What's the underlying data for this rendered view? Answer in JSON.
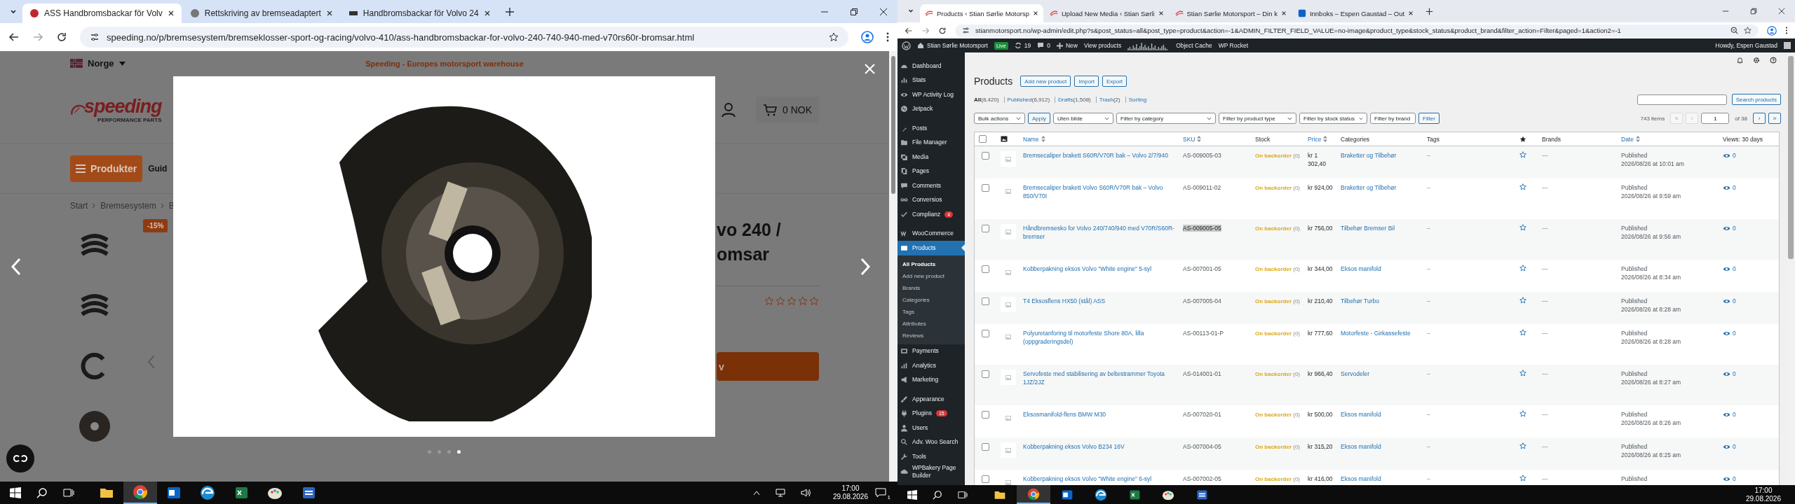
{
  "left_window": {
    "tabs": [
      {
        "title": "ASS Handbromsbackar för Volv",
        "selected": true
      },
      {
        "title": "Rettskriving av bremseadaptert",
        "selected": false
      },
      {
        "title": "Handbromsbackar för Volvo 24",
        "selected": false
      }
    ],
    "url": "speeding.no/p/bremsesystem/bremseklosser-sport-og-racing/volvo-410/ass-handbromsbackar-for-volvo-240-740-940-med-v70rs60r-bromsar.html",
    "site": {
      "country": "Norge",
      "tagline": "Speeding - Europes motorsport warehouse",
      "logo": "speeding",
      "logo_tagline": "PERFORMANCE PARTS",
      "cart": "0 NOK",
      "menu_button": "Produkter",
      "nav_link": "Guid",
      "breadcrumb": [
        "Start",
        "Bremsesystem",
        "B"
      ],
      "discount_badge": "-15%",
      "title_lines": [
        "vo 240 /",
        "omsar"
      ],
      "stars": 0,
      "cart_button": "v"
    },
    "lightbox": {
      "dots": [
        {
          "selected": false
        },
        {
          "selected": false
        },
        {
          "selected": false
        },
        {
          "selected": true
        }
      ]
    }
  },
  "left_taskbar": {
    "apps": [
      {
        "selected": false
      },
      {
        "selected": true
      },
      {
        "selected": false
      },
      {
        "selected": false
      },
      {
        "selected": false
      },
      {
        "selected": false
      },
      {
        "selected": false
      }
    ],
    "time": "17:00",
    "date": "29.08.2026",
    "notification_count": "1"
  },
  "right_window": {
    "tabs": [
      {
        "title": "Products ‹ Stian Sørlie Motorsp",
        "selected": true
      },
      {
        "title": "Upload New Media ‹ Stian Sørli",
        "selected": false
      },
      {
        "title": "Stian Sørlie Motorsport – Din k",
        "selected": false
      },
      {
        "title": "Innboks – Espen Gaustad – Out",
        "selected": false
      }
    ],
    "url": "stianmotorsport.no/wp-admin/edit.php?s&post_status=all&post_type=product&action=-1&ADMIN_FILTER_FIELD_VALUE=no-image&product_type&stock_status&product_brand&filter_action=Filter&paged=1&action2=-1",
    "admin_bar": {
      "site": "Stian Sørlie Motorsport",
      "live_badge": "Live",
      "updates": "19",
      "comments": "0",
      "new": "New",
      "view": "View products",
      "links": [
        "Object Cache",
        "WP Rocket"
      ],
      "howdy": "Howdy, Espen Gaustad"
    },
    "sidebar": [
      {
        "items": [
          {
            "label": "Dashboard",
            "selected": false
          },
          {
            "label": "Stats",
            "selected": false
          },
          {
            "label": "WP Activity Log",
            "selected": false
          },
          {
            "label": "Jetpack",
            "selected": false
          }
        ]
      },
      {
        "items": [
          {
            "label": "Posts",
            "selected": false
          },
          {
            "label": "File Manager",
            "selected": false
          },
          {
            "label": "Media",
            "selected": false
          },
          {
            "label": "Pages",
            "selected": false
          },
          {
            "label": "Comments",
            "selected": false
          },
          {
            "label": "Conversios",
            "selected": false
          },
          {
            "label": "Complianz",
            "selected": false,
            "badge": "4"
          }
        ]
      },
      {
        "items": [
          {
            "label": "WooCommerce",
            "selected": false
          },
          {
            "label": "Products",
            "selected": true,
            "children": [
              {
                "label": "All Products",
                "selected": true
              },
              {
                "label": "Add new product",
                "selected": false
              },
              {
                "label": "Brands",
                "selected": false
              },
              {
                "label": "Categories",
                "selected": false
              },
              {
                "label": "Tags",
                "selected": false
              },
              {
                "label": "Attributes",
                "selected": false
              },
              {
                "label": "Reviews",
                "selected": false
              }
            ]
          },
          {
            "label": "Payments",
            "selected": false
          },
          {
            "label": "Analytics",
            "selected": false
          },
          {
            "label": "Marketing",
            "selected": false
          }
        ]
      },
      {
        "items": [
          {
            "label": "Appearance",
            "selected": false
          },
          {
            "label": "Plugins",
            "selected": false,
            "badge": "15"
          },
          {
            "label": "Users",
            "selected": false
          },
          {
            "label": "Adv. Woo Search",
            "selected": false
          },
          {
            "label": "Tools",
            "selected": false
          },
          {
            "label": "WPBakery Page Builder",
            "selected": false
          }
        ]
      }
    ],
    "page": {
      "heading": "Products",
      "buttons": [
        "Add new product",
        "Import",
        "Export"
      ],
      "views": [
        {
          "label": "All",
          "count": "(8,420)",
          "selected": true
        },
        {
          "label": "Published",
          "count": "(6,912)",
          "selected": false
        },
        {
          "label": "Drafts",
          "count": "(1,508)",
          "selected": false
        },
        {
          "label": "Trash",
          "count": "(2)",
          "selected": false
        },
        {
          "label": "Sorting",
          "selected": false
        }
      ],
      "search_button": "Search products",
      "bulk_select": "Bulk actions",
      "apply_button": "Apply",
      "filters": [
        "Uten bilde",
        "Filter by category",
        "Filter by product type",
        "Filter by stock status",
        "Filter by brand"
      ],
      "filter_button": "Filter",
      "items_count": "743 items",
      "pagination": {
        "first": "«",
        "prev": "‹",
        "page": "1",
        "of": "of 38",
        "next": "›",
        "last": "»"
      }
    },
    "table": {
      "select_all_checked": false,
      "columns": [
        {
          "kind": "text",
          "label": "Name",
          "sortable": true
        },
        {
          "kind": "text",
          "label": "SKU",
          "sortable": true
        },
        {
          "kind": "text",
          "label": "Stock",
          "sortable": false
        },
        {
          "kind": "text",
          "label": "Price",
          "sortable": true
        },
        {
          "kind": "text",
          "label": "Categories",
          "sortable": false
        },
        {
          "kind": "text",
          "label": "Tags",
          "sortable": false
        },
        {
          "kind": "featured"
        },
        {
          "kind": "text",
          "label": "Brands",
          "sortable": false
        },
        {
          "kind": "text",
          "label": "Date",
          "sortable": true
        },
        {
          "kind": "text",
          "label": "Views: 30 days",
          "sortable": false
        }
      ],
      "rows": [
        {
          "checked": false,
          "name": "Bremsecaliper brakett S60R/V70R bak – Volvo 2/7/940",
          "sku": "AS-009005-03",
          "sku_highlighted": false,
          "stock": "On backorder",
          "stock_count": "(0)",
          "price": "kr 1 302,40",
          "category": "Braketter og Tilbehør",
          "tags": "–",
          "featured": false,
          "brands": "—",
          "status": "Published",
          "date": "2026/08/26 at 10:01 am",
          "views": "0"
        },
        {
          "checked": false,
          "name": "Bremsecaliper brakett Volvo S60R/V70R bak – Volvo 850/V70I",
          "sku": "AS-009011-02",
          "sku_highlighted": false,
          "stock": "On backorder",
          "stock_count": "(0)",
          "price": "kr 924,00",
          "category": "Braketter og Tilbehør",
          "tags": "–",
          "featured": false,
          "brands": "—",
          "status": "Published",
          "date": "2026/08/26 at 9:59 am",
          "views": "0"
        },
        {
          "checked": false,
          "name": "Håndbremsesko for Volvo 240/740/940 med V70R/S60R-bremser",
          "sku": "AS-009005-05",
          "sku_highlighted": true,
          "stock": "On backorder",
          "stock_count": "(0)",
          "price": "kr 756,00",
          "category": "Tilbehør Bremser Bil",
          "tags": "–",
          "featured": false,
          "brands": "—",
          "status": "Published",
          "date": "2026/08/26 at 9:56 am",
          "views": "0"
        },
        {
          "checked": false,
          "name": "Kobberpakning eksos Volvo \"White engine\" 5-syl",
          "sku": "AS-007001-05",
          "sku_highlighted": false,
          "stock": "On backorder",
          "stock_count": "(0)",
          "price": "kr 344,00",
          "category": "Eksos manifold",
          "tags": "–",
          "featured": false,
          "brands": "—",
          "status": "Published",
          "date": "2026/08/26 at 8:34 am",
          "views": "0"
        },
        {
          "checked": false,
          "name": "T4 Eksosflens HX50 (stål) ASS",
          "sku": "AS-007005-04",
          "sku_highlighted": false,
          "stock": "On backorder",
          "stock_count": "(0)",
          "price": "kr 210,40",
          "category": "Tilbehør Turbo",
          "tags": "–",
          "featured": false,
          "brands": "—",
          "status": "Published",
          "date": "2026/08/26 at 8:28 am",
          "views": "0"
        },
        {
          "checked": false,
          "name": "Polyuretanforing til motorfeste Shore 80A, lilla (oppgraderingsdel)",
          "sku": "AS-00113-01-P",
          "sku_highlighted": false,
          "stock": "On backorder",
          "stock_count": "(0)",
          "price": "kr 777,60",
          "category": "Motorfeste - Girkassefeste",
          "tags": "–",
          "featured": false,
          "brands": "—",
          "status": "Published",
          "date": "2026/08/26 at 8:28 am",
          "views": "0"
        },
        {
          "checked": false,
          "name": "Servofeste med stabilisering av beltestrammer Toyota 1JZ/2JZ",
          "sku": "AS-014001-01",
          "sku_highlighted": false,
          "stock": "On backorder",
          "stock_count": "(0)",
          "price": "kr 966,40",
          "category": "Servodeler",
          "tags": "–",
          "featured": false,
          "brands": "—",
          "status": "Published",
          "date": "2026/08/26 at 8:27 am",
          "views": "0"
        },
        {
          "checked": false,
          "name": "Eksosmanifold-flens BMW M30",
          "sku": "AS-007020-01",
          "sku_highlighted": false,
          "stock": "On backorder",
          "stock_count": "(0)",
          "price": "kr 500,00",
          "category": "Eksos manifold",
          "tags": "–",
          "featured": false,
          "brands": "—",
          "status": "Published",
          "date": "2026/08/26 at 8:26 am",
          "views": "0"
        },
        {
          "checked": false,
          "name": "Kobberpakning eksos Volvo B234 16V",
          "sku": "AS-007004-05",
          "sku_highlighted": false,
          "stock": "On backorder",
          "stock_count": "(0)",
          "price": "kr 315,20",
          "category": "Eksos manifold",
          "tags": "–",
          "featured": false,
          "brands": "—",
          "status": "Published",
          "date": "2026/08/26 at 8:25 am",
          "views": "0"
        },
        {
          "checked": false,
          "name": "Kobberpakning eksos Volvo \"White engine\" 6-syl",
          "sku": "AS-007002-05",
          "sku_highlighted": false,
          "stock": "On backorder",
          "stock_count": "(0)",
          "price": "kr 416,00",
          "category": "Eksos manifold",
          "tags": "–",
          "featured": false,
          "brands": "—",
          "status": "Published",
          "views": "0"
        }
      ]
    }
  },
  "right_taskbar": {
    "apps": [
      {
        "selected": false
      },
      {
        "selected": true
      },
      {
        "selected": false
      },
      {
        "selected": false
      },
      {
        "selected": false
      },
      {
        "selected": false
      },
      {
        "selected": false
      }
    ],
    "time": "17:00",
    "date": "29.08.2026"
  }
}
